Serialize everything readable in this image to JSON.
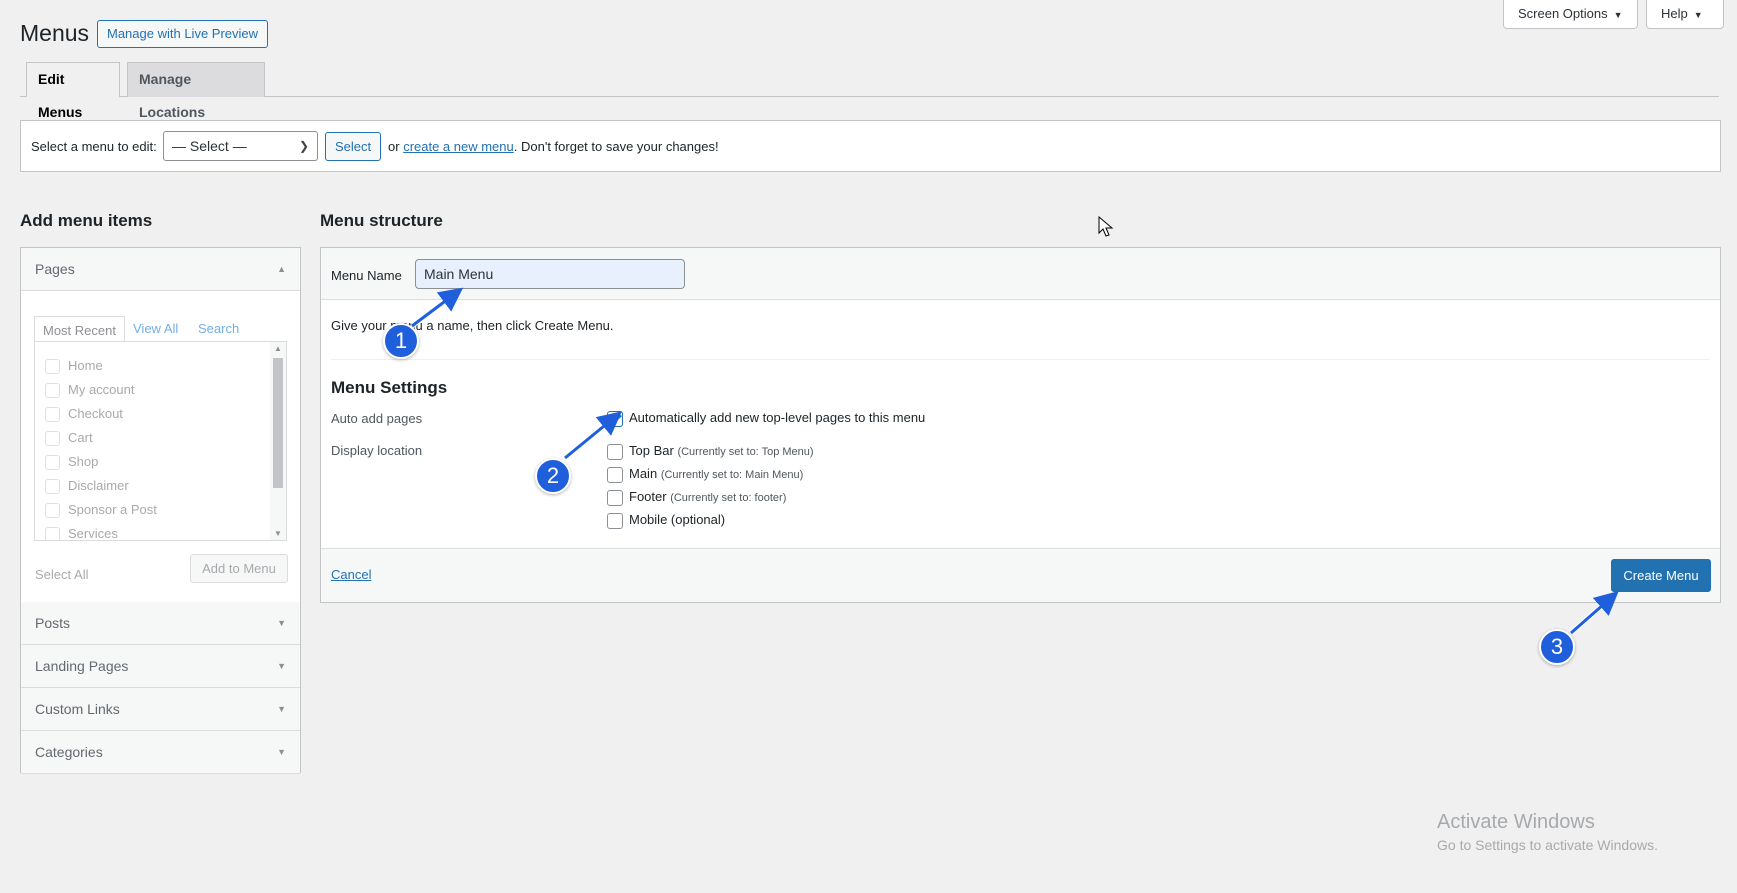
{
  "header": {
    "title": "Menus",
    "live_preview": "Manage with Live Preview",
    "screen_options": "Screen Options",
    "help": "Help"
  },
  "tabs": {
    "edit_menus": "Edit Menus",
    "manage_locations": "Manage Locations"
  },
  "select_bar": {
    "label": "Select a menu to edit:",
    "dropdown_value": "— Select —",
    "select_button": "Select",
    "or_text": "or",
    "create_link": "create a new menu",
    "reminder": ". Don't forget to save your changes!"
  },
  "add_items": {
    "heading": "Add menu items",
    "pages_section": "Pages",
    "page_tabs": [
      "Most Recent",
      "View All",
      "Search"
    ],
    "pages": [
      "Home",
      "My account",
      "Checkout",
      "Cart",
      "Shop",
      "Disclaimer",
      "Sponsor a Post",
      "Services"
    ],
    "select_all": "Select All",
    "add_to_menu": "Add to Menu",
    "sections": [
      "Posts",
      "Landing Pages",
      "Custom Links",
      "Categories"
    ]
  },
  "structure": {
    "heading": "Menu structure",
    "menu_name_label": "Menu Name",
    "menu_name_value": "Main Menu",
    "instruction": "Give your menu a name, then click Create Menu.",
    "settings_title": "Menu Settings",
    "auto_add_label": "Auto add pages",
    "auto_add_option": "Automatically add new top-level pages to this menu",
    "display_location_label": "Display location",
    "locations": [
      {
        "name": "Top Bar",
        "note": "(Currently set to: Top Menu)"
      },
      {
        "name": "Main",
        "note": "(Currently set to: Main Menu)"
      },
      {
        "name": "Footer",
        "note": "(Currently set to: footer)"
      },
      {
        "name": "Mobile (optional)",
        "note": ""
      }
    ],
    "cancel": "Cancel",
    "create_menu": "Create Menu"
  },
  "annotations": [
    "1",
    "2",
    "3"
  ],
  "watermark": {
    "line1": "Activate Windows",
    "line2": "Go to Settings to activate Windows."
  },
  "colors": {
    "accent": "#2271b1",
    "badge": "#1f5fdc",
    "background": "#f0f0f1"
  }
}
